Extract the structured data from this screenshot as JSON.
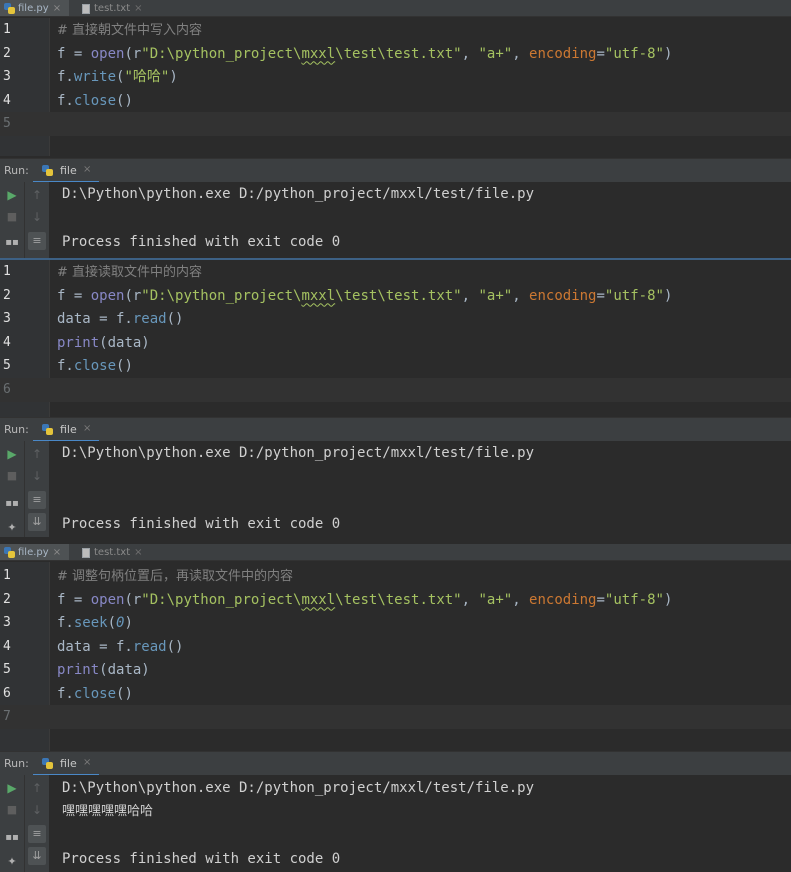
{
  "tabs": [
    {
      "label": "file.py",
      "close": "×"
    },
    {
      "label": "test.txt",
      "close": "×"
    }
  ],
  "editor1": {
    "lines": [
      {
        "n": "1",
        "tokens": [
          {
            "c": "cmt",
            "t": "# 直接朝文件中写入内容"
          }
        ]
      },
      {
        "n": "2",
        "tokens": [
          {
            "c": "",
            "t": "f = "
          },
          {
            "c": "builtin",
            "t": "open"
          },
          {
            "c": "",
            "t": "(r"
          },
          {
            "c": "str",
            "t": "\"D:\\python_project\\"
          },
          {
            "c": "str squig",
            "t": "mxxl"
          },
          {
            "c": "str",
            "t": "\\test\\test.txt\""
          },
          {
            "c": "",
            "t": ", "
          },
          {
            "c": "str",
            "t": "\"a+\""
          },
          {
            "c": "",
            "t": ", "
          },
          {
            "c": "kw",
            "t": "encoding"
          },
          {
            "c": "",
            "t": "="
          },
          {
            "c": "str",
            "t": "\"utf-8\""
          },
          {
            "c": "",
            "t": ")"
          }
        ]
      },
      {
        "n": "3",
        "tokens": [
          {
            "c": "",
            "t": "f."
          },
          {
            "c": "meth",
            "t": "write"
          },
          {
            "c": "",
            "t": "("
          },
          {
            "c": "str",
            "t": "\"哈哈\""
          },
          {
            "c": "",
            "t": ")"
          }
        ]
      },
      {
        "n": "4",
        "tokens": [
          {
            "c": "",
            "t": "f."
          },
          {
            "c": "meth",
            "t": "close"
          },
          {
            "c": "",
            "t": "()"
          }
        ]
      },
      {
        "n": "5",
        "tokens": []
      }
    ]
  },
  "run1": {
    "label": "Run:",
    "tab": "file",
    "close": "×",
    "output": [
      "D:\\Python\\python.exe D:/python_project/mxxl/test/file.py",
      "",
      "Process finished with exit code 0"
    ]
  },
  "editor2": {
    "lines": [
      {
        "n": "1",
        "tokens": [
          {
            "c": "cmt",
            "t": "# 直接读取文件中的内容"
          }
        ]
      },
      {
        "n": "2",
        "tokens": [
          {
            "c": "",
            "t": "f = "
          },
          {
            "c": "builtin",
            "t": "open"
          },
          {
            "c": "",
            "t": "(r"
          },
          {
            "c": "str",
            "t": "\"D:\\python_project\\"
          },
          {
            "c": "str squig",
            "t": "mxxl"
          },
          {
            "c": "str",
            "t": "\\test\\test.txt\""
          },
          {
            "c": "",
            "t": ", "
          },
          {
            "c": "str",
            "t": "\"a+\""
          },
          {
            "c": "",
            "t": ", "
          },
          {
            "c": "kw",
            "t": "encoding"
          },
          {
            "c": "",
            "t": "="
          },
          {
            "c": "str",
            "t": "\"utf-8\""
          },
          {
            "c": "",
            "t": ")"
          }
        ]
      },
      {
        "n": "3",
        "tokens": [
          {
            "c": "",
            "t": "data = f."
          },
          {
            "c": "meth",
            "t": "read"
          },
          {
            "c": "",
            "t": "()"
          }
        ]
      },
      {
        "n": "4",
        "tokens": [
          {
            "c": "builtin",
            "t": "print"
          },
          {
            "c": "",
            "t": "(data)"
          }
        ]
      },
      {
        "n": "5",
        "tokens": [
          {
            "c": "",
            "t": "f."
          },
          {
            "c": "meth",
            "t": "close"
          },
          {
            "c": "",
            "t": "()"
          }
        ]
      },
      {
        "n": "6",
        "tokens": []
      }
    ]
  },
  "run2": {
    "label": "Run:",
    "tab": "file",
    "close": "×",
    "output": [
      "D:\\Python\\python.exe D:/python_project/mxxl/test/file.py",
      "",
      "",
      "Process finished with exit code 0"
    ]
  },
  "editor3": {
    "lines": [
      {
        "n": "1",
        "tokens": [
          {
            "c": "cmt",
            "t": "# 调整句柄位置后，再读取文件中的内容"
          }
        ]
      },
      {
        "n": "2",
        "tokens": [
          {
            "c": "",
            "t": "f = "
          },
          {
            "c": "builtin",
            "t": "open"
          },
          {
            "c": "",
            "t": "(r"
          },
          {
            "c": "str",
            "t": "\"D:\\python_project\\"
          },
          {
            "c": "str squig",
            "t": "mxxl"
          },
          {
            "c": "str",
            "t": "\\test\\test.txt\""
          },
          {
            "c": "",
            "t": ", "
          },
          {
            "c": "str",
            "t": "\"a+\""
          },
          {
            "c": "",
            "t": ", "
          },
          {
            "c": "kw",
            "t": "encoding"
          },
          {
            "c": "",
            "t": "="
          },
          {
            "c": "str",
            "t": "\"utf-8\""
          },
          {
            "c": "",
            "t": ")"
          }
        ]
      },
      {
        "n": "3",
        "tokens": [
          {
            "c": "",
            "t": "f."
          },
          {
            "c": "meth",
            "t": "seek"
          },
          {
            "c": "",
            "t": "("
          },
          {
            "c": "num",
            "t": "0"
          },
          {
            "c": "",
            "t": ")"
          }
        ]
      },
      {
        "n": "4",
        "tokens": [
          {
            "c": "",
            "t": "data = f."
          },
          {
            "c": "meth",
            "t": "read"
          },
          {
            "c": "",
            "t": "()"
          }
        ]
      },
      {
        "n": "5",
        "tokens": [
          {
            "c": "builtin",
            "t": "print"
          },
          {
            "c": "",
            "t": "(data)"
          }
        ]
      },
      {
        "n": "6",
        "tokens": [
          {
            "c": "",
            "t": "f."
          },
          {
            "c": "meth",
            "t": "close"
          },
          {
            "c": "",
            "t": "()"
          }
        ]
      },
      {
        "n": "7",
        "tokens": []
      }
    ]
  },
  "run3": {
    "label": "Run:",
    "tab": "file",
    "close": "×",
    "output": [
      "D:\\Python\\python.exe D:/python_project/mxxl/test/file.py",
      "嘿嘿嘿嘿嘿哈哈",
      "",
      "Process finished with exit code 0"
    ]
  },
  "colors": {
    "bg": "#2b2b2b",
    "gutter": "#313335",
    "toolbar": "#3c3f41",
    "string": "#a5c261",
    "keyword": "#cc7832",
    "comment": "#808080",
    "builtin": "#8888c6",
    "accent": "#4a88c7"
  }
}
